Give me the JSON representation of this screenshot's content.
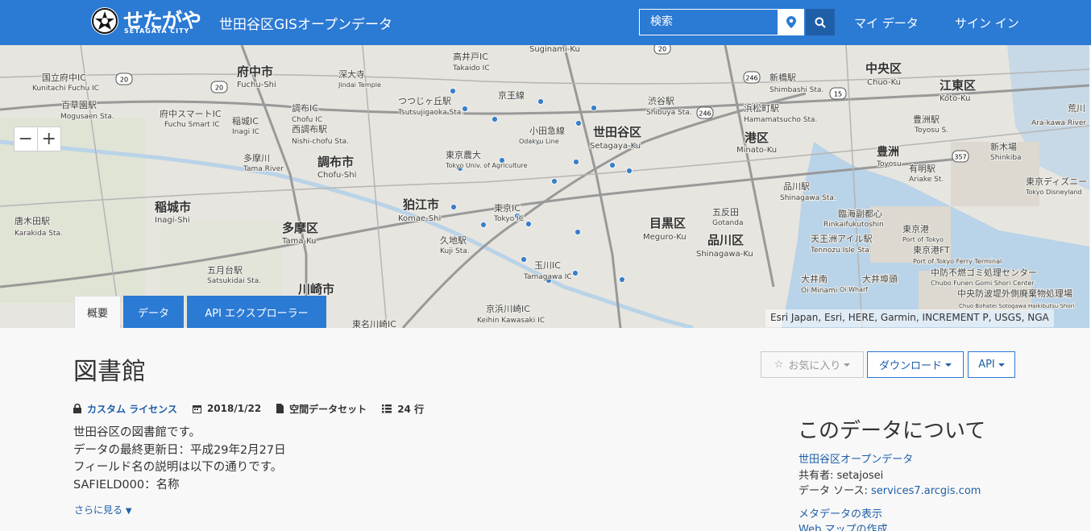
{
  "header": {
    "logo_text": "せたがや",
    "logo_sub": "SETAGAYA CITY",
    "site_title": "世田谷区GISオープンデータ",
    "search_placeholder": "検索",
    "nav_my_data": "マイ データ",
    "nav_sign_in": "サイン イン",
    "bg_color": "#2b7ad4"
  },
  "map": {
    "attribution": "Esri Japan, Esri, HERE, Garmin, INCREMENT P, USGS, NGA",
    "labels": [
      {
        "text": "府中市"
      },
      {
        "text": "Fuchu-Shi"
      },
      {
        "text": "調布市"
      },
      {
        "text": "Chofu-Shi"
      },
      {
        "text": "狛江市"
      },
      {
        "text": "Komae-Shi"
      },
      {
        "text": "稲城市"
      },
      {
        "text": "Inagi-Shi"
      },
      {
        "text": "多摩区"
      },
      {
        "text": "Tama-Ku"
      },
      {
        "text": "川崎市"
      },
      {
        "text": "世田谷区"
      },
      {
        "text": "Setagaya-Ku"
      },
      {
        "text": "目黒区"
      },
      {
        "text": "Meguro-Ku"
      },
      {
        "text": "品川区"
      },
      {
        "text": "Shinagawa-Ku"
      },
      {
        "text": "港区"
      },
      {
        "text": "Minato-Ku"
      },
      {
        "text": "中央区"
      },
      {
        "text": "Chuo-Ku"
      },
      {
        "text": "江東区"
      },
      {
        "text": "Koto-Ku"
      },
      {
        "text": "豊洲"
      },
      {
        "text": "Toyosu"
      },
      {
        "text": "Suginami-Ku"
      },
      {
        "text": "渋谷駅"
      },
      {
        "text": "Shibuya Sta."
      },
      {
        "text": "新橋駅"
      },
      {
        "text": "Shimbashi Sta."
      },
      {
        "text": "浜松町駅"
      },
      {
        "text": "Hamamatsucho Sta."
      },
      {
        "text": "品川駅"
      },
      {
        "text": "Shinagawa Sta."
      },
      {
        "text": "豊洲駅"
      },
      {
        "text": "Toyosu S."
      },
      {
        "text": "有明駅"
      },
      {
        "text": "Ariake St."
      },
      {
        "text": "新木場"
      },
      {
        "text": "Shinkiba"
      },
      {
        "text": "東京ディズニー"
      },
      {
        "text": "Tokyo Disneyland"
      },
      {
        "text": "つつじヶ丘駅"
      },
      {
        "text": "Tsutsujigaoka Sta."
      },
      {
        "text": "高井戸IC"
      },
      {
        "text": "Takaido IC"
      },
      {
        "text": "調布IC"
      },
      {
        "text": "Chofu IC"
      },
      {
        "text": "西調布駅"
      },
      {
        "text": "Nishi-chofu Sta."
      },
      {
        "text": "府中スマートIC"
      },
      {
        "text": "Fuchu Smart IC"
      },
      {
        "text": "稲城IC"
      },
      {
        "text": "Inagi IC"
      },
      {
        "text": "東京農大"
      },
      {
        "text": "Tokyo Univ. of Agriculture"
      },
      {
        "text": "東京IC"
      },
      {
        "text": "Tokyo IC"
      },
      {
        "text": "久地駅"
      },
      {
        "text": "Kuji Sta."
      },
      {
        "text": "玉川IC"
      },
      {
        "text": "Tamagawa IC"
      },
      {
        "text": "五反田"
      },
      {
        "text": "Gotanda"
      },
      {
        "text": "臨海副都心"
      },
      {
        "text": "Rinkaifukutoshin"
      },
      {
        "text": "天王洲アイル駅"
      },
      {
        "text": "Tennozu Isle Sta."
      },
      {
        "text": "東京港"
      },
      {
        "text": "Port of Tokyo"
      },
      {
        "text": "東京港FT"
      },
      {
        "text": "Port of Tokyo Ferry Terminal"
      },
      {
        "text": "中防不燃ゴミ処理センター"
      },
      {
        "text": "Chubo Funen Gomi Shori Center"
      },
      {
        "text": "中央防波堤外側廃棄物処理場"
      },
      {
        "text": "Chuo Bohatei Sotogawa Haikibutsu Shori"
      },
      {
        "text": "大井埠頭"
      },
      {
        "text": "Oi Wharf"
      },
      {
        "text": "大井南"
      },
      {
        "text": "Oi Minami"
      },
      {
        "text": "唐木田駅"
      },
      {
        "text": "Karakida Sta."
      },
      {
        "text": "百草園駅"
      },
      {
        "text": "Mogusaen Sta."
      },
      {
        "text": "国立府中IC"
      },
      {
        "text": "Kunitachi Fuchu IC"
      },
      {
        "text": "五月台駅"
      },
      {
        "text": "Satsukidai Sta."
      },
      {
        "text": "京浜川崎IC"
      },
      {
        "text": "Keihin Kawasaki IC"
      },
      {
        "text": "東名川崎IC"
      },
      {
        "text": "深大寺"
      },
      {
        "text": "Jindai Temple"
      },
      {
        "text": "多摩川"
      },
      {
        "text": "Tama River"
      },
      {
        "text": "荒川"
      },
      {
        "text": "Ara-kawa River"
      },
      {
        "text": "小田急線"
      },
      {
        "text": "Odakyu Line"
      },
      {
        "text": "京王線"
      }
    ],
    "shield_labels": [
      "20",
      "20",
      "20",
      "246",
      "246",
      "15",
      "357"
    ],
    "dot_color": "#3a7fc8"
  },
  "tabs": {
    "overview": "概要",
    "data": "データ",
    "api_explorer": "API エクスプローラー"
  },
  "dataset": {
    "title": "図書館",
    "favorite_label": "お気に入り",
    "download_label": "ダウンロード",
    "api_label": "API",
    "license": "カスタム ライセンス",
    "date": "2018/1/22",
    "type": "空間データセット",
    "rows": "24 行",
    "description": [
      "世田谷区の図書館です。",
      "データの最終更新日：平成29年2月27日",
      "フィールド名の説明は以下の通りです。",
      "SAFIELD000：名称"
    ],
    "more_label": "さらに見る"
  },
  "about": {
    "title": "このデータについて",
    "org_link": "世田谷区オープンデータ",
    "shared_by": "共有者: setajosei",
    "source_label": "データ ソース: ",
    "source_link": "services7.arcgis.com",
    "metadata_link": "メタデータの表示",
    "webmap_link": "Web マップの作成"
  }
}
